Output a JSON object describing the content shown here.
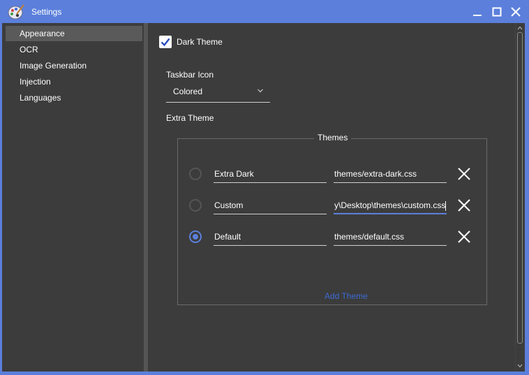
{
  "window": {
    "title": "Settings",
    "accent_color": "#5b7fdb",
    "controls": [
      "minimize-icon",
      "maximize-icon",
      "close-icon"
    ]
  },
  "sidebar": {
    "items": [
      {
        "label": "Appearance",
        "selected": true
      },
      {
        "label": "OCR",
        "selected": false
      },
      {
        "label": "Image Generation",
        "selected": false
      },
      {
        "label": "Injection",
        "selected": false
      },
      {
        "label": "Languages",
        "selected": false
      }
    ]
  },
  "appearance": {
    "dark_theme": {
      "label": "Dark Theme",
      "checked": true
    },
    "taskbar_icon": {
      "label": "Taskbar Icon",
      "value": "Colored"
    },
    "extra_theme_label": "Extra Theme",
    "themes_group": {
      "title": "Themes",
      "rows": [
        {
          "name": "Extra Dark",
          "path": "themes/extra-dark.css",
          "selected": false
        },
        {
          "name": "Custom",
          "path": "...y\\Desktop\\themes\\custom.css",
          "path_visible": "y\\Desktop\\themes\\custom.css",
          "selected": false,
          "focused": true
        },
        {
          "name": "Default",
          "path": "themes/default.css",
          "selected": true
        }
      ],
      "add_label": "Add Theme"
    }
  }
}
